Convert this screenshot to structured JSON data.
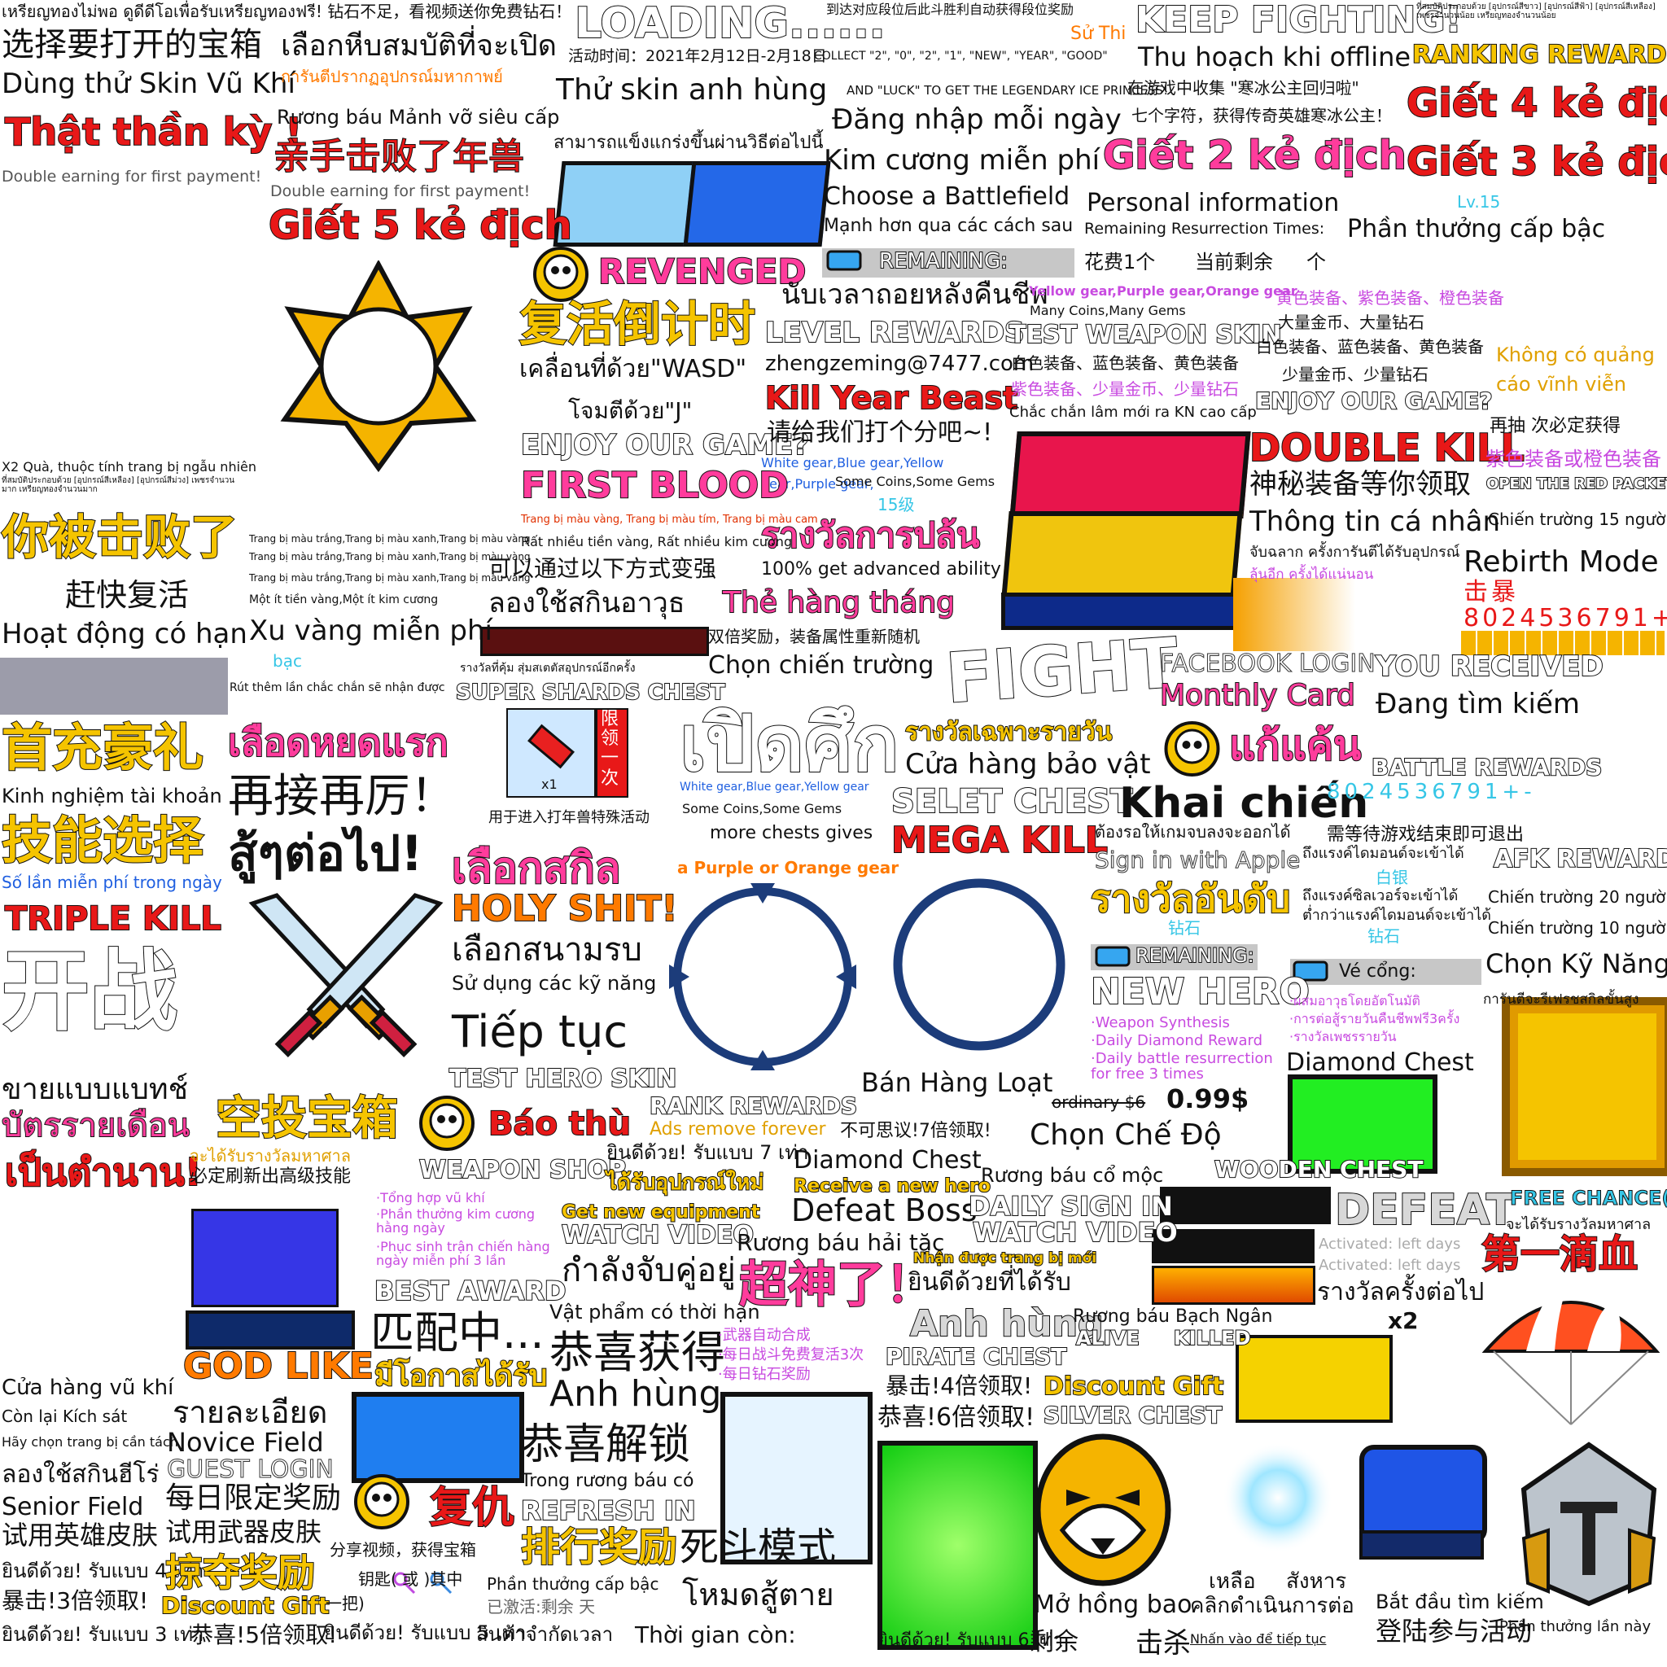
{
  "texts": {
    "t01": "เหรียญทองไม่พอ ดูดีดีโอเพื่อรับเหรียญทองฟรี! 钻石不足，看视频送你免费钻石！",
    "t02": "选择要打开的宝箱",
    "t03": "เลือกหีบสมบัติที่จะเปิด",
    "t04": "Dùng thử Skin Vũ Khí",
    "t05": "การันตีปรากฏอุปกรณ์มหากาพย์",
    "t06": "Thật thần kỳ !",
    "t07": "Double earning for first payment!",
    "t08": "Rương báu Mảnh vỡ siêu cấp",
    "t09": "亲手击败了年兽",
    "t10": "Double earning for first payment!",
    "t11": "Giết 5 kẻ địch",
    "t12": "LOADING......",
    "t13": "活动时间：2021年2月12日-2月18日",
    "t14": "COLLECT \"2\", \"0\", \"2\", \"1\", \"NEW\", \"YEAR\", \"GOOD\"",
    "t15": "AND \"LUCK\" TO GET THE LEGENDARY ICE PRINCESS!",
    "t16": "Thử skin anh hùng",
    "t17": "สามารถแข็งแกร่งขึ้นผ่านวิธีต่อไปนี้",
    "t18": "到达对应段位后此斗胜利自动获得段位奖励",
    "t19": "Sử Thi",
    "t20": "KEEP FIGHTING!",
    "t21": "Thu hoạch khi offline",
    "t22": "RANKING REWARDS",
    "t23": "在游戏中收集 \"寒冰公主回归啦\"",
    "t24": "七个字符，获得传奇英雄寒冰公主！",
    "t25": "Đăng nhập mỗi ngày",
    "t26": "Giết 4 kẻ địch",
    "t27": "Kim cương miễn phí",
    "t28": "Giết 2 kẻ địch",
    "t29": "Giết 3 kẻ địch",
    "t30": "Choose a Battlefield",
    "t31": "Personal information",
    "t32": "Lv.15",
    "t33": "Mạnh hơn qua các cách sau",
    "t34": "Remaining Resurrection Times:",
    "t35": "Phần thưởng cấp bậc",
    "t36": "REMAINING:",
    "t37": "花费1个",
    "t38": "当前剩余",
    "t39": "个",
    "t40": "REVENGED",
    "t41": "复活倒计时",
    "t42": "นับเวลาถอยหลังคืนชีพ",
    "t43": "LEVEL REWARDS",
    "t44": "TEST WEAPON SKIN",
    "t45": "Yellow gear,Purple gear,Orange gear",
    "t46": "Many Coins,Many Gems",
    "t47": "黄色装备、紫色装备、橙色装备",
    "t48": "大量金币、大量钻石",
    "t49": "白色装备、蓝色装备、黄色装备",
    "t50": "Không có quảng cáo vĩnh viễn",
    "t51": "เคลื่อนที่ด้วย\"WASD\"",
    "t52": "zhengzeming@7477.com",
    "t53": "白色装备、蓝色装备、黄色装备",
    "t54": "少量金币、少量钻石",
    "t55": "Kill Year Beast",
    "t56": "紫色装备、少量金币、少量钻石",
    "t57": "ENJOY OUR GAME?",
    "t58": "โจมตีด้วย\"J\"",
    "t59": "Chắc chắn lâm mới ra KN cao cấp",
    "t60": "再抽 次必定获得",
    "t61": "ENJOY OUR GAME?",
    "t62": "请给我们打个分吧~!",
    "t63": "DOUBLE KILL",
    "t64": "紫色装备或橙色装备",
    "t65": "White gear,Blue gear,Yellow gear,Purple gear,",
    "t66": "Some Coins,Some Gems",
    "t67": "FIRST BLOOD",
    "t68": "神秘装备等你领取",
    "t69": "OPEN THE RED PACKET",
    "t70": "15级",
    "t71": "Thông tin cá nhân",
    "t72": "Chiến trường 15 người",
    "t73": "X2 Quà, thuộc tính trang bị ngẫu nhiên",
    "t74": "Trang bị màu vàng, Trang bị màu tím, Trang bị màu cam",
    "t75": "รางวัลการปล้น",
    "t76": "Rất nhiều tiền vàng, Rất nhiều kim cương",
    "t77": "100% get advanced ability",
    "t78": "จับฉลาก ครั้งการันตีได้รับอุปกรณ์",
    "t79": "Rebirth Mode",
    "t80": "你被击败了",
    "t81": "Trang bị màu trắng,Trang bị màu xanh,Trang bị màu vàng",
    "t82": "可以通过以下方式变强",
    "t83": "击暴8024536791+-",
    "t84": "赶快复活",
    "t85": "Một ít tiền vàng,Một ít kim cương",
    "t86": "ลองใช้สกินอาวุธ",
    "t87": "Thẻ hàng tháng",
    "t88": "Hoạt động có hạn",
    "t89": "Xu vàng miễn phí",
    "t90": "双倍奖励，装备属性重新随机",
    "t91": "FIGHT",
    "t92": "FACEBOOK LOGIN",
    "t93": "YOU RECEIVED",
    "t94": "bạc",
    "t95": "Chọn chiến trường",
    "t96": "Monthly Card",
    "t97": "Đang tìm kiếm",
    "t98": "Rút thêm lần chắc chắn sẽ nhận được",
    "t99": "SUPER SHARDS CHEST",
    "t100": "รางวัลที่คุ้ม สุ่มสเตตัสอุปกรณ์อีกครั้ง",
    "t101": "首充豪礼",
    "t102": "เลือดหยดแรก",
    "t103": "เปิดศึก",
    "t104": "รางวัลเฉพาะรายวัน",
    "t105": "แก้แค้น",
    "t106": "Kinh nghiệm tài khoản",
    "t107": "再接再厉！",
    "t108": "Cửa hàng bảo vật",
    "t109": "BATTLE REWARDS",
    "t110": "技能选择",
    "t111": "สู้ๆต่อไป!",
    "t112": "用于进入打年兽特殊活动",
    "t113": "White gear,Blue gear,Yellow gear",
    "t114": "SELET CHEST",
    "t115": "Khai chiến",
    "t116": "8024536791+-",
    "t117": "Some Coins,Some Gems",
    "t118": "more chests gives",
    "t119": "MEGA KILL",
    "t120": "Số lần miễn phí trong ngày",
    "t121": "เลือกสกิล",
    "t122": "a Purple or Orange gear",
    "t123": "ต้องรอให้เกมจบลงจะออกได้",
    "t124": "需等待游戏结束即可退出",
    "t125": "Sign in with Apple",
    "t126": "AFK REWARD",
    "t127": "TRIPLE KILL",
    "t128": "HOLY SHIT!",
    "t129": "รางวัลอันดับ",
    "t130": "白银",
    "t131": "Chiến trường 20 người",
    "t132": "开战",
    "t133": "เลือกสนามรบ",
    "t134": "钻石",
    "t135": "Chiến trường 10 người",
    "t136": "Sử dụng các kỹ năng",
    "t137": "REMAINING:",
    "t138": "Vé cổng:",
    "t139": "Chọn Kỹ Năng",
    "t140": "NEW HERO",
    "t141": "Tiếp tục",
    "t142": "·Weapon Synthesis",
    "t143": "·Daily Diamond Reward",
    "t144": "·Daily battle resurrection for free 3 times",
    "t145": "Diamond Chest",
    "t146": "ขายแบบแบทช์",
    "t147": "TEST HERO SKIN",
    "t148": "RANK REWARDS",
    "t149": "Bán Hàng Loạt",
    "t150": "ordinary $6",
    "t151": "0.99$",
    "t152": "บัตรรายเดือน",
    "t153": "空投宝箱",
    "t154": "Báo thù",
    "t155": "Ads remove forever",
    "t156": "不可思议!7倍领取!",
    "t157": "Chọn Chế Độ",
    "t158": "เป็นตำนาน!",
    "t159": "必定刷新出高级技能",
    "t160": "WEAPON SHOP",
    "t161": "ยินดีด้วย! รับแบบ 7 เท่า",
    "t162": "Diamond Chest",
    "t163": "Rương báu cổ mộc",
    "t164": "WOODEN CHEST",
    "t165": "ได้รับอุปกรณ์ใหม่",
    "t166": "Receive a new hero",
    "t167": "DEFEAT",
    "t168": "FREE CHANCE(S) :",
    "t169": "Defeat Boss",
    "t170": "DAILY SIGN IN",
    "t171": "Get new equipment",
    "t172": "WATCH VIDEO",
    "t173": "WATCH VIDEO",
    "t174": "Rương báu hải tặc",
    "t175": "Nhận được trang bị mới",
    "t176": "Activated: left days",
    "t177": "第一滴血",
    "t178": "กำลังจับคู่อยู่",
    "t179": "超神了！",
    "t180": "ยินดีด้วยที่ได้รับ",
    "t181": "รางวัลครั้งต่อไป",
    "t182": "BEST AWARD",
    "t183": "Vật phẩm có thời hạn",
    "t184": "Anh hùng",
    "t185": "Rương báu Bạch Ngân",
    "t186": "ALIVE",
    "t187": "KILLED",
    "t188": "x2",
    "t189": "匹配中...",
    "t190": "恭喜获得",
    "t191": "·武器自动合成",
    "t192": "·每日战斗免费复活3次",
    "t193": "·每日钻石奖励",
    "t194": "GOD LIKE",
    "t195": "PIRATE CHEST",
    "t196": "มีโอกาสได้รับ",
    "t197": "Cửa hàng vũ khí",
    "t198": "暴击!4倍领取!",
    "t199": "Discount Gift",
    "t200": "Anh hùng",
    "t201": "Còn lại Kích sát",
    "t202": "รายละเอียด",
    "t203": "恭喜!6倍领取!",
    "t204": "SILVER CHEST",
    "t205": "Hãy chọn trang bị cần tách",
    "t206": "Novice Field",
    "t207": "恭喜解锁",
    "t208": "ลองใช้สกินฮีโร่",
    "t209": "GUEST LOGIN",
    "t210": "Trong rương báu có",
    "t211": "Senior Field",
    "t212": "每日限定奖励",
    "t213": "REFRESH IN",
    "t214": "试用英雄皮肤",
    "t215": "试用武器皮肤",
    "t216": "排行奖励",
    "t217": "死斗模式",
    "t218": "分享视频，获得宝箱",
    "t219": "ยินดีด้วย! รับแบบ 4 เท่า",
    "t220": "掠夺奖励",
    "t221": "钥匙( 或 )其中",
    "t222": "Phần thưởng cấp bậc",
    "t223": "เหลือ",
    "t224": "สังหาร",
    "t225": "暴击!3倍领取!",
    "t226": "Discount Gift",
    "t227": "一把)",
    "t228": "已激活:剩余 天",
    "t229": "โหมดสู้ตาย",
    "t230": "Mở hồng bao",
    "t231": "คลิกดำเนินการต่อ",
    "t232": "Bắt đầu tìm kiếm",
    "t233": "ยินดีด้วย! รับแบบ 3 เท่า",
    "t234": "恭喜!5倍领取!",
    "t235": "ยินดีด้วย! รับแบบ 5 เท่า",
    "t236": "สินค้าจำกัดเวลา",
    "t237": "Thời gian còn:",
    "t238": "ยินดีด้วย! รับแบบ 6 เท่า",
    "t239": "剩余",
    "t240": "击杀",
    "t241": "Nhấn vào để tiếp tục",
    "t242": "登陆参与活动",
    "t243": "Phần thưởng lần này",
    "t244": "·Tổng hợp vũ khí",
    "t245": "·Phần thưởng kim cương hằng ngày",
    "t246": "·Phục sinh trận chiến hàng ngày miễn phí 3 lần",
    "t247": "ลุ้นอีก ครั้งได้แน่นอน",
    "t248": "จะได้รับรางวัลมหาศาล",
    "t249": "การันตีจะรีเฟรชสกิลขั้นสูง",
    "t250": "ถึงแรงค์ไดมอนด์จะเข้าได้",
    "t251": "ถึงแรงค์ซิลเวอร์จะเข้าได้",
    "t252": "ต่ำกว่าแรงค์ไดมอนด์จะเข้าได้",
    "t253": "x1",
    "t254": "限领一次",
    "t255": "·ผสมอาวุธโดยอัตโนมัติ",
    "t256": "·การต่อสู้รายวันคืนชีพฟรี3ครั้ง",
    "t257": "·รางวัลเพชรรายวัน",
    "t258": "ที่สมบัติประกอบด้วย [อุปกรณ์สีเหลือง] [อุปกรณ์สีม่วง] เพชรจำนวนมาก เหรียญทองจำนวนมาก",
    "t259": "ที่สมบัติประกอบด้วย [อุปกรณ์สีขาว] [อุปกรณ์สีฟ้า] [อุปกรณ์สีเหลือง] เพชรจำนวนน้อย เหรียญทองจำนวนน้อย"
  },
  "colors": {
    "accent_red": "#e81818",
    "accent_yellow": "#f5c400",
    "accent_orange": "#ff7a00",
    "accent_pink": "#ff3c9c",
    "accent_cyan": "#36c6e6",
    "panel_blue": "#1f5fe0",
    "panel_green": "#22dd22",
    "panel_gold": "#e8b400"
  },
  "icons": [
    "star-badge-icon",
    "skull-laurel-icon",
    "crossed-swords-icon",
    "firecracker-icon",
    "ticket-icon",
    "parachute-icon",
    "knight-helmet-icon",
    "tiger-mask-icon",
    "glow-orb-icon",
    "circular-frame-icon",
    "ring-frame-icon",
    "key-icon"
  ]
}
